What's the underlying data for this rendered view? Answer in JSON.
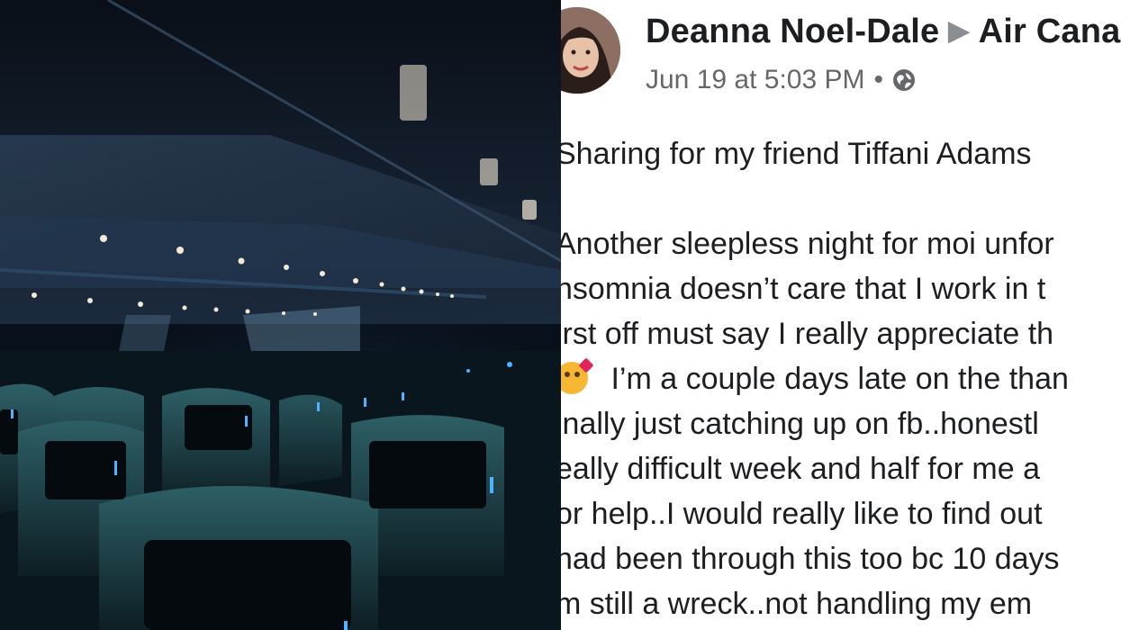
{
  "photo": {
    "description_icon": "airplane-cabin-photo"
  },
  "post": {
    "author": "Deanna Noel-Dale",
    "arrow": "▶",
    "target": "Air Cana",
    "timestamp": "Jun 19 at 5:03 PM",
    "separator": "•",
    "privacy_icon": "globe-icon",
    "lines": {
      "l1": "Sharing for my friend Tiffani Adams",
      "l2": "Another sleepless night for moi unfor",
      "l3": "nsomnia doesn’t care that I work in t",
      "l4": "irst off must say I really appreciate th",
      "l5": " I’m a couple days late on the than",
      "l6": "inally just catching up on fb..honestl",
      "l7": "eally difficult week and half for me a",
      "l8": "or help..I would really like to find out",
      "l9": "had been through this too bc 10 days",
      "l10": "m still a wreck..not handling my em"
    }
  }
}
